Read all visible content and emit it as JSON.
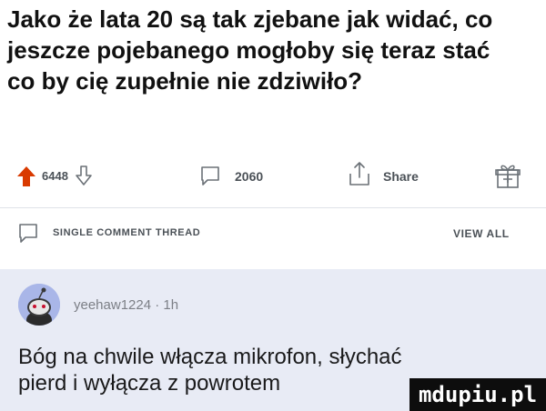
{
  "post": {
    "title": "Jako że lata 20 są tak zjebane jak widać, co jeszcze pojebanego mogłoby się teraz stać co by cię zupełnie nie zdziwiło?"
  },
  "actions": {
    "score": "6448",
    "comments": "2060",
    "share_label": "Share",
    "upvote_color": "#d93a00",
    "icons": [
      "upvote-icon",
      "downvote-icon",
      "comment-icon",
      "share-icon",
      "award-icon"
    ]
  },
  "thread": {
    "label": "SINGLE COMMENT THREAD",
    "view_all": "VIEW ALL"
  },
  "comment": {
    "user_meta": "yeehaw1224 · 1h",
    "body": "Bóg na chwile włącza mikrofon, słychać pierd i wyłącza z powrotem"
  },
  "watermark": {
    "text": "mdupiu.pl"
  }
}
